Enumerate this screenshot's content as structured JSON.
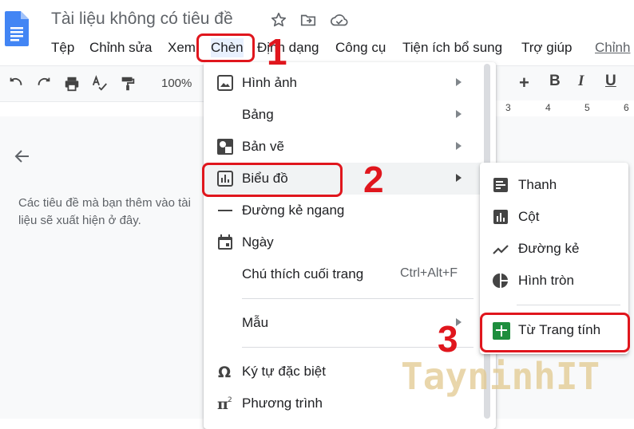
{
  "app": {
    "doc_title": "Tài liệu không có tiêu đề",
    "icons": [
      "docs-logo-icon",
      "star-icon",
      "move-to-folder-icon",
      "cloud-saved-icon"
    ]
  },
  "menubar": {
    "items": [
      "Tệp",
      "Chỉnh sửa",
      "Xem",
      "Chèn",
      "Định dạng",
      "Công cụ",
      "Tiện ích bổ sung",
      "Trợ giúp"
    ],
    "last_edit": "Chỉnh"
  },
  "toolbar": {
    "zoom": "100%",
    "plus": "+",
    "bold": "B",
    "italic": "I",
    "underline": "U",
    "icons": [
      "undo-icon",
      "redo-icon",
      "print-icon",
      "spellcheck-icon",
      "paint-format-icon"
    ]
  },
  "ruler": {
    "numbers": [
      "3",
      "4",
      "5",
      "6"
    ]
  },
  "outline": {
    "back_icon": "arrow-left-icon",
    "text": "Các tiêu đề mà bạn thêm vào tài liệu sẽ xuất hiện ở đây."
  },
  "insert_menu": {
    "items": [
      {
        "label": "Hình ảnh",
        "icon": "image-icon",
        "submenu": true
      },
      {
        "label": "Bảng",
        "icon": "",
        "submenu": true
      },
      {
        "label": "Bản vẽ",
        "icon": "drawing-icon",
        "submenu": true
      },
      {
        "label": "Biểu đồ",
        "icon": "chart-icon",
        "submenu": true
      },
      {
        "label": "Đường kẻ ngang",
        "icon": "horizontal-line-icon",
        "submenu": false
      },
      {
        "label": "Ngày",
        "icon": "calendar-icon",
        "submenu": false
      },
      {
        "label": "Chú thích cuối trang",
        "icon": "",
        "shortcut": "Ctrl+Alt+F"
      },
      {
        "label": "Mẫu",
        "icon": "",
        "submenu": true
      },
      {
        "label": "Ký tự đặc biệt",
        "icon": "omega-icon",
        "submenu": false
      },
      {
        "label": "Phương trình",
        "icon": "pi-squared-icon",
        "submenu": false
      }
    ]
  },
  "chart_menu": {
    "items": [
      {
        "label": "Thanh",
        "icon": "bar-chart-icon"
      },
      {
        "label": "Cột",
        "icon": "column-chart-icon"
      },
      {
        "label": "Đường kẻ",
        "icon": "line-chart-icon"
      },
      {
        "label": "Hình tròn",
        "icon": "pie-chart-icon"
      },
      {
        "label": "Từ Trang tính",
        "icon": "sheets-icon"
      }
    ]
  },
  "annotations": {
    "step1": "1",
    "step2": "2",
    "step3": "3",
    "color": "#e0161d"
  },
  "watermark": "TayninhIT"
}
